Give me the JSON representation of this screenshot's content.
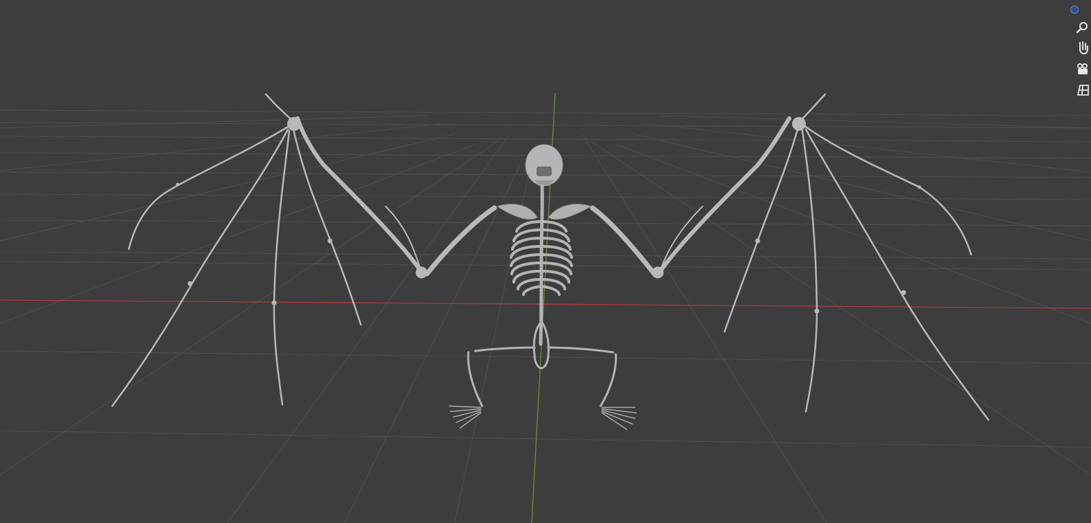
{
  "viewport": {
    "background": "#3d3d3d",
    "grid_color": "#545454",
    "x_axis_color": "#b23b40",
    "y_axis_color": "#6b9a2a",
    "model_color": "#b8b8b8",
    "model_shadow_color": "#7d7d7d"
  },
  "scene": {
    "object": "bat-skeleton",
    "shading": "solid"
  },
  "navigation": {
    "gizmo_icon": "view-orientation-dot",
    "tools": [
      {
        "name": "zoom-icon"
      },
      {
        "name": "pan-hand-icon"
      },
      {
        "name": "camera-view-icon"
      },
      {
        "name": "perspective-grid-icon"
      }
    ],
    "accent": "#4772b3"
  }
}
